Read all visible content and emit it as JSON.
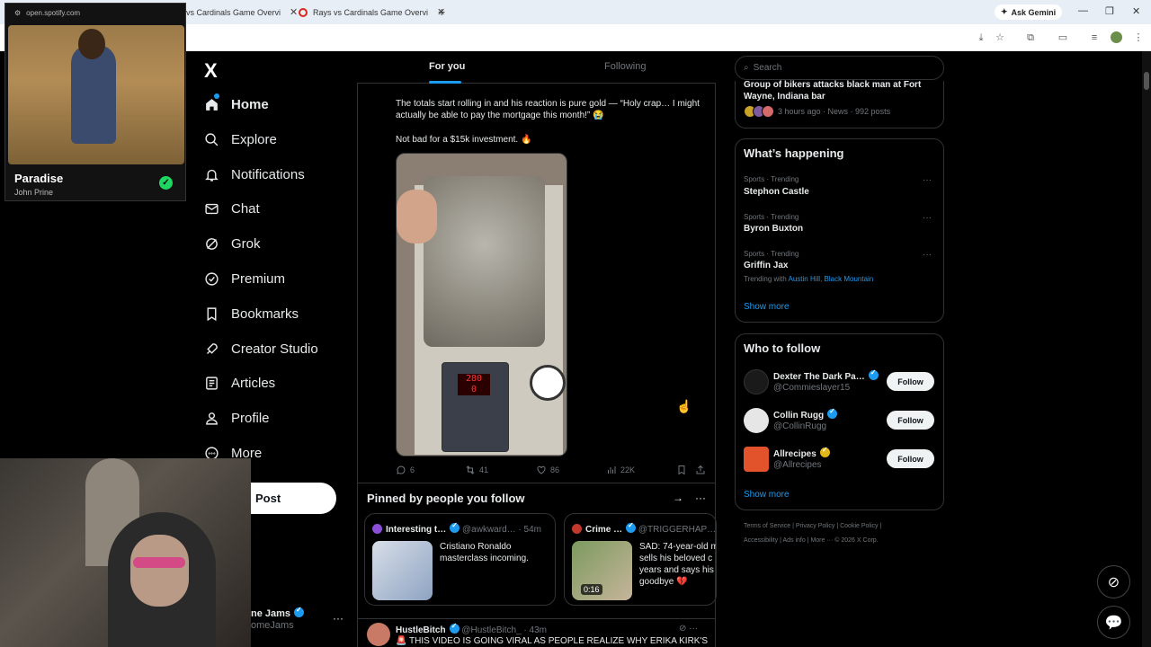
{
  "browser": {
    "tabs": [
      {
        "label": "vs Cardinals Game Overvi"
      },
      {
        "label": "Rays vs Cardinals Game Overvi"
      }
    ],
    "ask_gemini": "Ask Gemini"
  },
  "spotify": {
    "url": "open.spotify.com",
    "track": "Paradise",
    "artist": "John Prine"
  },
  "nav": {
    "logo": "X",
    "items": [
      {
        "label": "Home",
        "icon": "home-icon"
      },
      {
        "label": "Explore",
        "icon": "search-icon"
      },
      {
        "label": "Notifications",
        "icon": "bell-icon"
      },
      {
        "label": "Chat",
        "icon": "mail-icon"
      },
      {
        "label": "Grok",
        "icon": "grok-icon"
      },
      {
        "label": "Premium",
        "icon": "premium-icon"
      },
      {
        "label": "Bookmarks",
        "icon": "bookmark-icon"
      },
      {
        "label": "Creator Studio",
        "icon": "rocket-icon"
      },
      {
        "label": "Articles",
        "icon": "article-icon"
      },
      {
        "label": "Profile",
        "icon": "person-icon"
      },
      {
        "label": "More",
        "icon": "more-circle-icon"
      }
    ],
    "post_button": "Post",
    "account": {
      "name": "ne Jams",
      "handle": "omeJams"
    }
  },
  "feed": {
    "tabs": {
      "for_you": "For you",
      "following": "Following"
    },
    "tweet": {
      "text1": "The totals start rolling in and his reaction is pure gold — “Holy crap… I might actually be able to pay the mortgage this month!” 😭",
      "text2": "Not bad for a $15k investment. 🔥",
      "media_display": "280",
      "media_display2": "0",
      "replies": "6",
      "reposts": "41",
      "likes": "86",
      "views": "22K"
    },
    "pinned": {
      "title": "Pinned by people you follow",
      "cards": [
        {
          "name": "Interesting t…",
          "handle": "@awkward…",
          "time": "· 54m",
          "text": "Cristiano Ronaldo masterclass incoming."
        },
        {
          "name": "Crime …",
          "handle": "@TRIGGERHAP…",
          "text": "SAD: 74-year-old m sells his beloved c years and says his goodbye 💔",
          "duration": "0:16"
        }
      ]
    },
    "next_tweet": {
      "name": "HustleBitch",
      "handle": "@HustleBitch_",
      "time": "· 43m",
      "text": "🚨 THIS VIDEO IS GOING VIRAL AS PEOPLE REALIZE WHY ERIKA KIRK'S"
    }
  },
  "sidebar": {
    "search_placeholder": "Search",
    "news": {
      "title": "Group of bikers attacks black man at Fort Wayne, Indiana bar",
      "meta": "3 hours ago · News · 992 posts"
    },
    "happening": {
      "title": "What’s happening",
      "trends": [
        {
          "category": "Sports · Trending",
          "name": "Stephon Castle"
        },
        {
          "category": "Sports · Trending",
          "name": "Byron Buxton"
        },
        {
          "category": "Sports · Trending",
          "name": "Griffin Jax"
        }
      ],
      "trending_with_prefix": "Trending with",
      "trending_with_1": "Austin Hill",
      "trending_with_2": "Black Mountain",
      "show_more": "Show more"
    },
    "who_to_follow": {
      "title": "Who to follow",
      "accounts": [
        {
          "name": "Dexter The Dark Pa…",
          "handle": "@Commieslayer15",
          "follow": "Follow"
        },
        {
          "name": "Collin Rugg",
          "handle": "@CollinRugg",
          "follow": "Follow"
        },
        {
          "name": "Allrecipes",
          "handle": "@Allrecipes",
          "follow": "Follow"
        }
      ],
      "show_more": "Show more"
    },
    "footer": {
      "line1": "Terms of Service  |  Privacy Policy  |  Cookie Policy  |",
      "line2": "Accessibility  |  Ads info  |  More ···  © 2026 X Corp."
    }
  },
  "colors": {
    "accent": "#1d9bf0",
    "background": "#000000",
    "border": "#2f3336",
    "muted": "#71767b"
  }
}
